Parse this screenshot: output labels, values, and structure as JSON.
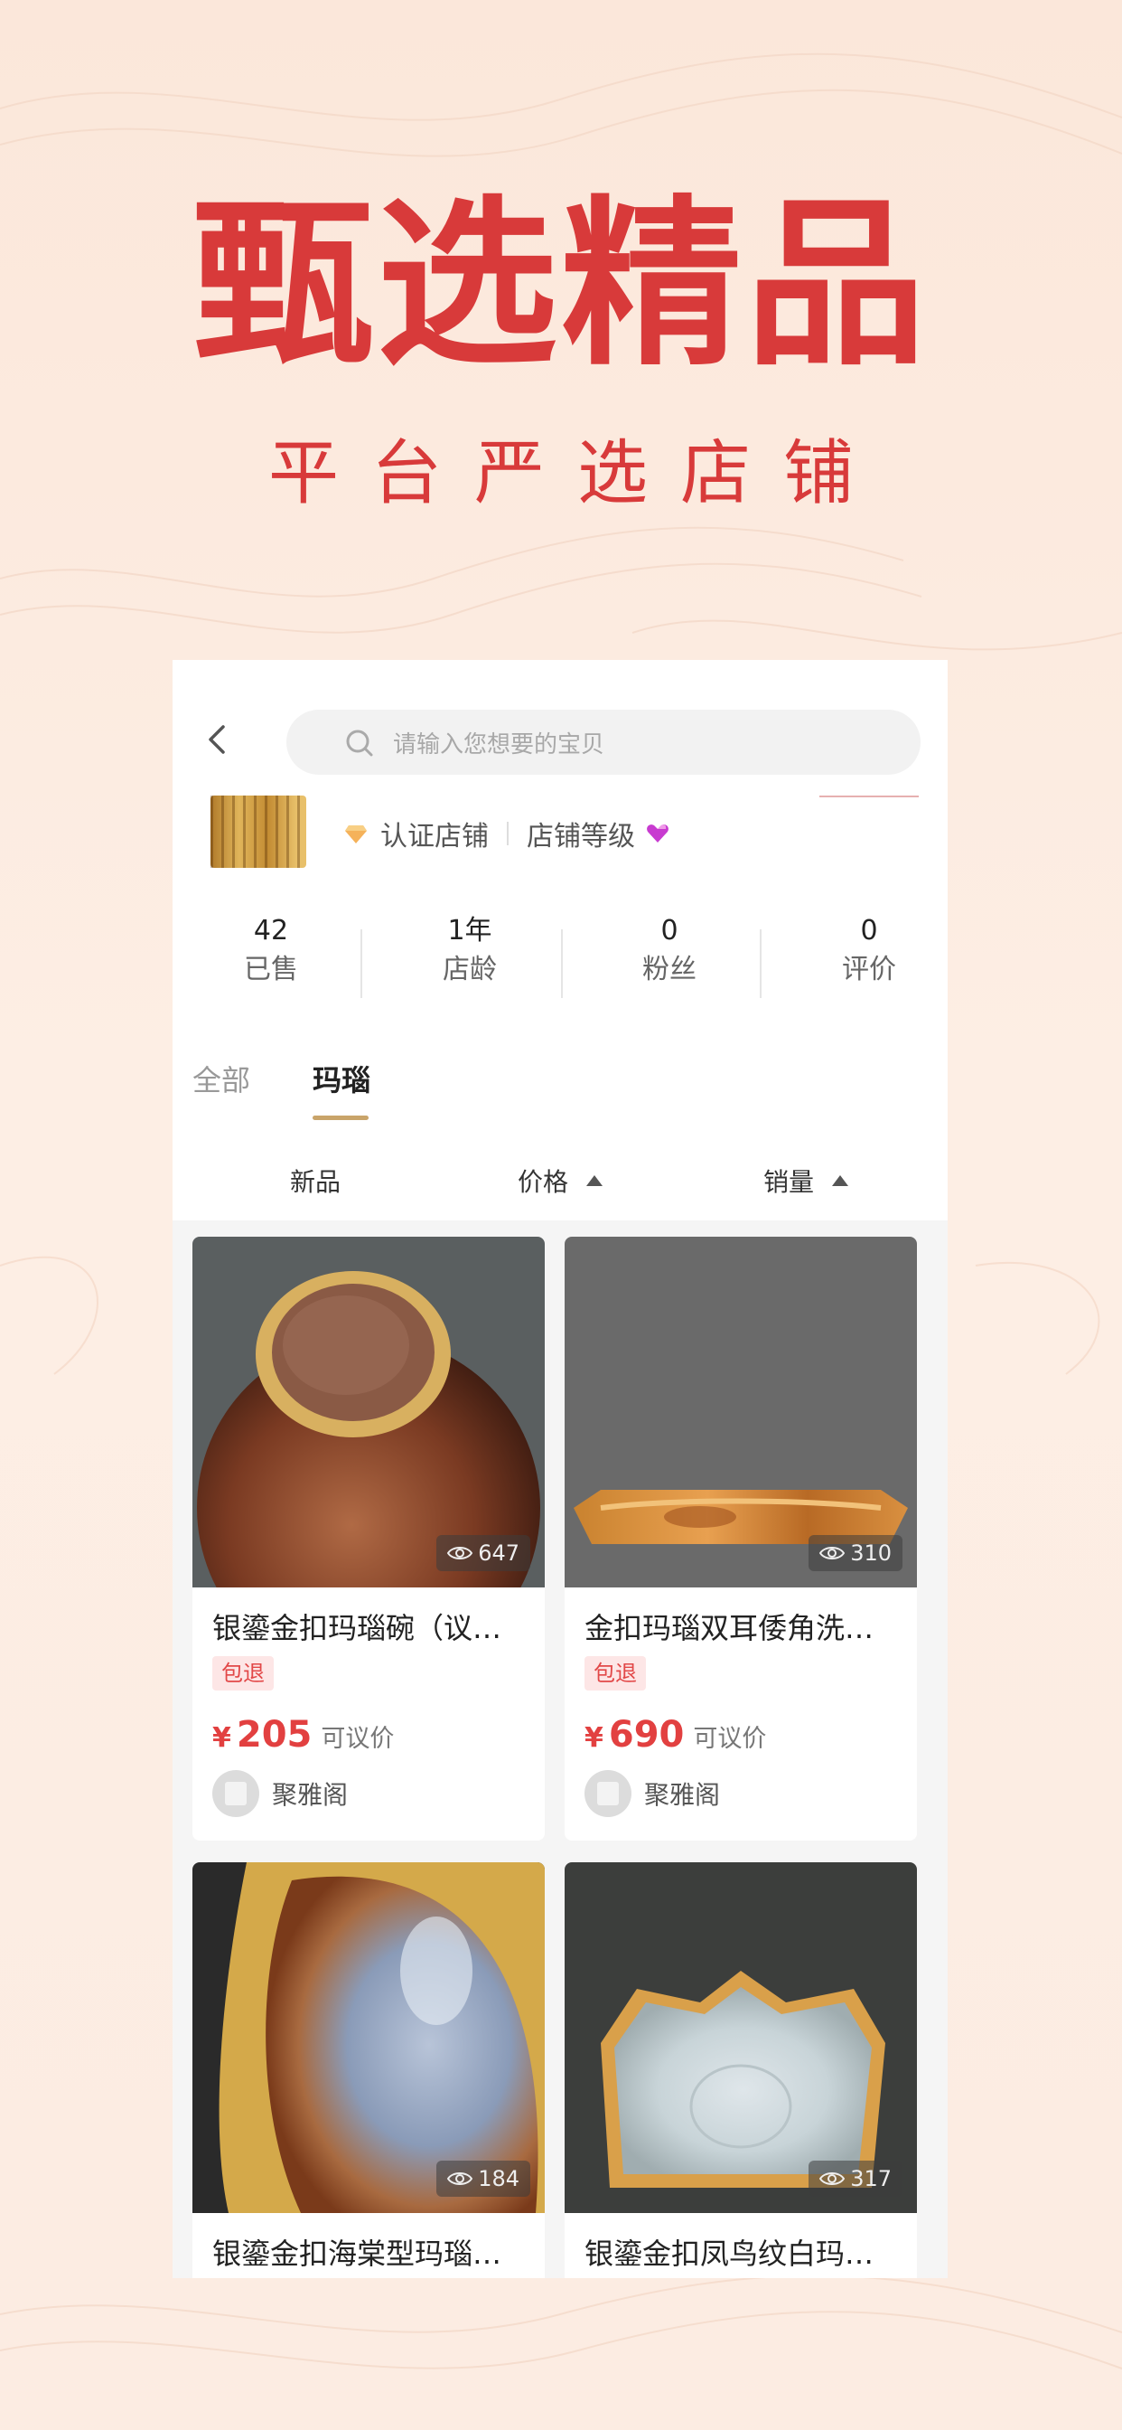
{
  "hero": {
    "title": "甄选精品",
    "subtitle": "平台严选店铺"
  },
  "search": {
    "placeholder": "请输入您想要的宝贝"
  },
  "store": {
    "certified": "认证店铺",
    "level": "店铺等级"
  },
  "stats": [
    {
      "value": "42",
      "label": "已售"
    },
    {
      "value": "1年",
      "label": "店龄"
    },
    {
      "value": "0",
      "label": "粉丝"
    },
    {
      "value": "0",
      "label": "评价"
    }
  ],
  "tabs": [
    {
      "label": "全部",
      "active": false
    },
    {
      "label": "玛瑙",
      "active": true
    }
  ],
  "sort": {
    "new": "新品",
    "price": "价格",
    "sales": "销量"
  },
  "products": [
    {
      "title": "银鎏金扣玛瑙碗（议…",
      "tag": "包退",
      "currency": "¥",
      "price": "205",
      "negotiable": "可议价",
      "shop": "聚雅阁",
      "views": "647"
    },
    {
      "title": "金扣玛瑙双耳倭角洗…",
      "tag": "包退",
      "currency": "¥",
      "price": "690",
      "negotiable": "可议价",
      "shop": "聚雅阁",
      "views": "310"
    },
    {
      "title": "银鎏金扣海棠型玛瑙…",
      "views": "184"
    },
    {
      "title": "银鎏金扣凤鸟纹白玛…",
      "views": "317"
    }
  ],
  "colors": {
    "accent": "#d83a3a",
    "price": "#e24040",
    "tab_underline": "#c9a46a"
  }
}
